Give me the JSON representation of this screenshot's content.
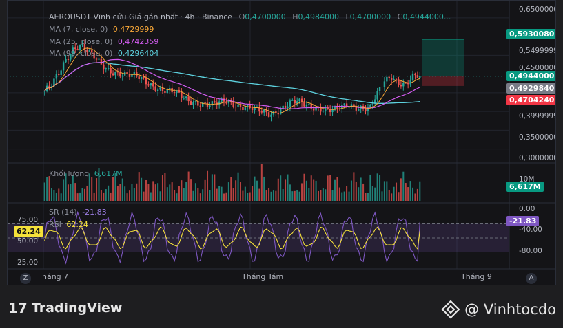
{
  "header": {
    "symbol": "AEROUSDT Vĩnh cửu Giá gần nhất · 4h · Binance",
    "ohlc": [
      {
        "label": "O",
        "value": "0,4700000"
      },
      {
        "label": "H",
        "value": "0,4984000"
      },
      {
        "label": "L",
        "value": "0,4700000"
      },
      {
        "label": "C",
        "value": "0,4944000..."
      }
    ]
  },
  "ma": [
    {
      "label": "MA (7, close, 0)",
      "value": "0,4729999",
      "color": "#f7a738"
    },
    {
      "label": "MA (25, close, 0)",
      "value": "0,4742359",
      "color": "#d25cf0"
    },
    {
      "label": "MA (99, close, 0)",
      "value": "0,4296404",
      "color": "#5ed3e0"
    }
  ],
  "volume_legend": {
    "label": "Khối lượng",
    "value": "6,617M",
    "color": "#26a69a"
  },
  "rsi_legend": {
    "label1": "SR (14)",
    "value1": "-21.83",
    "label2": "RSI",
    "value2": "62.24"
  },
  "price_axis": [
    "0,6500000",
    "0,5499999",
    "0,4500000",
    "0,3999999",
    "0,3500000",
    "0,3000000"
  ],
  "price_pills": [
    {
      "value": "0,5930080",
      "color": "#089981"
    },
    {
      "value": "0,4944000",
      "color": "#089981"
    },
    {
      "value": "0,4929840",
      "color": "#787b86"
    },
    {
      "value": "0,4704240",
      "color": "#f23645"
    }
  ],
  "volume_axis": {
    "tick": "10M",
    "pill": "6,617M",
    "pill_color": "#089981"
  },
  "wr_axis": [
    "0.00",
    "-40.00",
    "-80.00"
  ],
  "wr_pill": {
    "value": "-21.83",
    "color": "#7e57c2"
  },
  "rsi_axis": [
    "75.00",
    "50.00",
    "25.00"
  ],
  "rsi_pill": {
    "value": "62.24",
    "color": "#f5e13a"
  },
  "x_axis": [
    "háng 7",
    "Tháng Tám",
    "Tháng 9"
  ],
  "corner_left": "Z",
  "corner_right": "A",
  "footer": {
    "brand_logo": "17",
    "brand_name": "TradingView",
    "author": "@ Vinhtocdo"
  },
  "chart_data": {
    "type": "candlestick",
    "timeframe": "4h",
    "ylim": [
      0.27,
      0.67
    ],
    "close_series": [
      0.455,
      0.47,
      0.5,
      0.54,
      0.57,
      0.58,
      0.56,
      0.54,
      0.52,
      0.51,
      0.505,
      0.5,
      0.495,
      0.49,
      0.48,
      0.47,
      0.46,
      0.455,
      0.45,
      0.44,
      0.43,
      0.425,
      0.42,
      0.415,
      0.42,
      0.43,
      0.425,
      0.415,
      0.41,
      0.405,
      0.4,
      0.395,
      0.4,
      0.41,
      0.42,
      0.425,
      0.42,
      0.415,
      0.41,
      0.405,
      0.4,
      0.41,
      0.42,
      0.415,
      0.41,
      0.405,
      0.44,
      0.48,
      0.495,
      0.48,
      0.47,
      0.49,
      0.4944
    ],
    "ma7_last": 0.4729999,
    "ma25_last": 0.4742359,
    "ma99_last": 0.4296404,
    "volume_last": "6,617M",
    "rsi_last": 62.24,
    "williams_r_last": -21.83,
    "position_tool": {
      "take_profit": 0.593008,
      "entry": 0.4944,
      "stop": 0.470424
    }
  }
}
